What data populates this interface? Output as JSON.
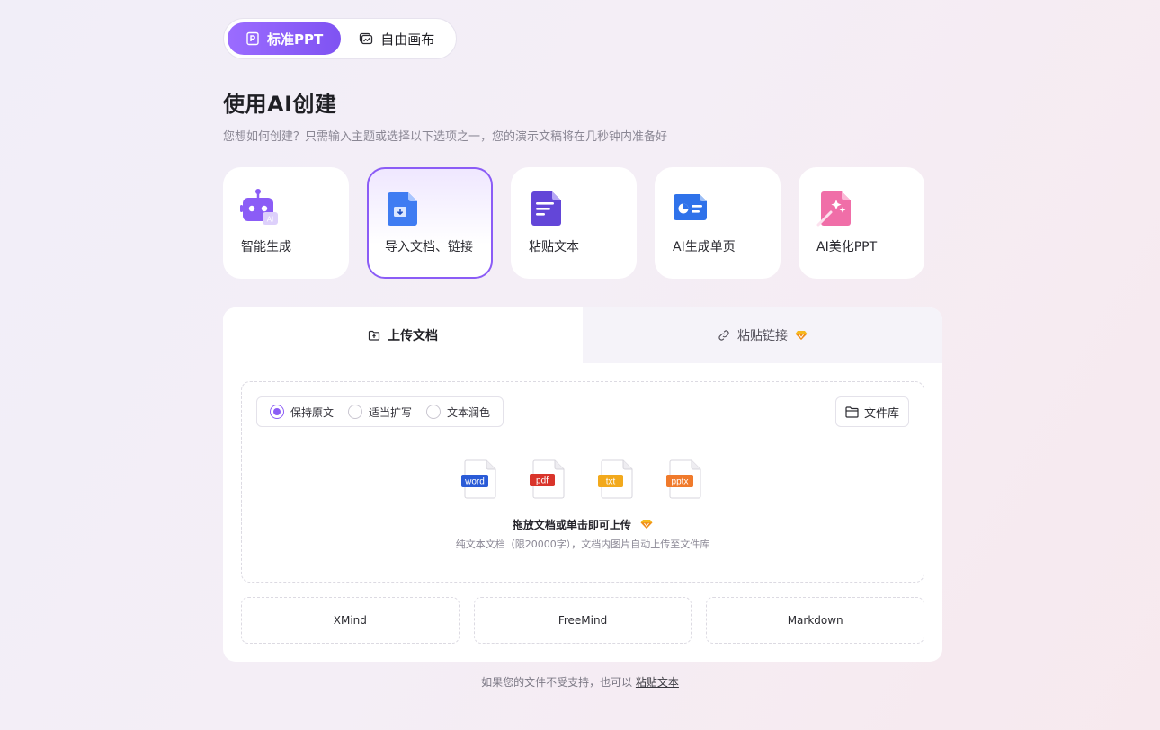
{
  "mode_switch": {
    "standard": "标准PPT",
    "freeform": "自由画布"
  },
  "heading": {
    "title": "使用AI创建",
    "subtitle": "您想如何创建？只需输入主题或选择以下选项之一，您的演示文稿将在几秒钟内准备好"
  },
  "cards": [
    {
      "label": "智能生成",
      "icon": "ai-robot-icon"
    },
    {
      "label": "导入文档、链接",
      "icon": "import-document-icon"
    },
    {
      "label": "粘贴文本",
      "icon": "paste-text-icon"
    },
    {
      "label": "AI生成单页",
      "icon": "single-page-icon"
    },
    {
      "label": "AI美化PPT",
      "icon": "beautify-icon"
    }
  ],
  "tabs": {
    "upload": "上传文档",
    "link": "粘贴链接"
  },
  "radio_options": [
    "保持原文",
    "适当扩写",
    "文本润色"
  ],
  "library_button": "文件库",
  "file_types": [
    "word",
    "pdf",
    "txt",
    "pptx"
  ],
  "upload": {
    "title": "拖放文档或单击即可上传",
    "subtitle": "纯文本文档（限20000字），文档内图片自动上传至文件库"
  },
  "formats": [
    "XMind",
    "FreeMind",
    "Markdown"
  ],
  "footer": {
    "text": "如果您的文件不受支持，也可以",
    "link": "粘贴文本"
  },
  "colors": {
    "accent": "#8b5cf6",
    "word": "#2a5bd7",
    "pdf": "#d9342b",
    "txt": "#f2a91c",
    "pptx": "#f07a2b"
  }
}
